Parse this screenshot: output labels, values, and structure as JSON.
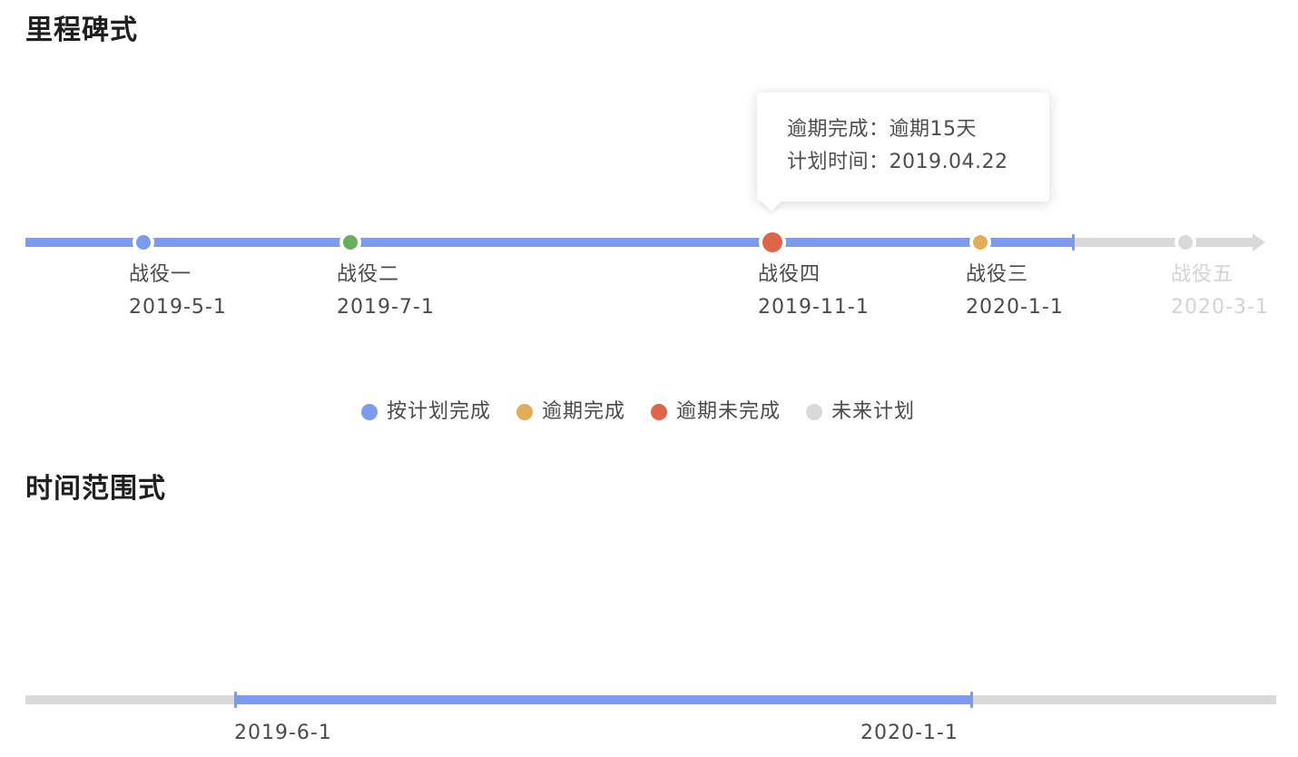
{
  "sections": {
    "milestone_title": "里程碑式",
    "range_title": "时间范围式"
  },
  "colors": {
    "on_schedule": "#7b9cec",
    "overdue_completed": "#e2ad5b",
    "overdue_incomplete": "#dd6549",
    "future": "#d9d9d9",
    "special_green": "#6aad5f"
  },
  "milestones": [
    {
      "name": "战役一",
      "date": "2019-5-1",
      "status": "on_schedule",
      "dot_color": "#7b9cec"
    },
    {
      "name": "战役二",
      "date": "2019-7-1",
      "status": "on_schedule",
      "dot_color": "#6aad5f"
    },
    {
      "name": "战役四",
      "date": "2019-11-1",
      "status": "overdue_incomplete",
      "dot_color": "#dd6549"
    },
    {
      "name": "战役三",
      "date": "2020-1-1",
      "status": "overdue_completed",
      "dot_color": "#e2ad5b"
    },
    {
      "name": "战役五",
      "date": "2020-3-1",
      "status": "future",
      "dot_color": "#d9d9d9"
    }
  ],
  "tooltip": {
    "line1_label": "逾期完成：",
    "line1_value": "逾期15天",
    "line2_label": "计划时间：",
    "line2_value": "2019.04.22"
  },
  "legend": [
    {
      "label": "按计划完成",
      "color": "#7b9cec"
    },
    {
      "label": "逾期完成",
      "color": "#e2ad5b"
    },
    {
      "label": "逾期未完成",
      "color": "#dd6549"
    },
    {
      "label": "未来计划",
      "color": "#d9d9d9"
    }
  ],
  "range": {
    "start": "2019-6-1",
    "end": "2020-1-1"
  }
}
